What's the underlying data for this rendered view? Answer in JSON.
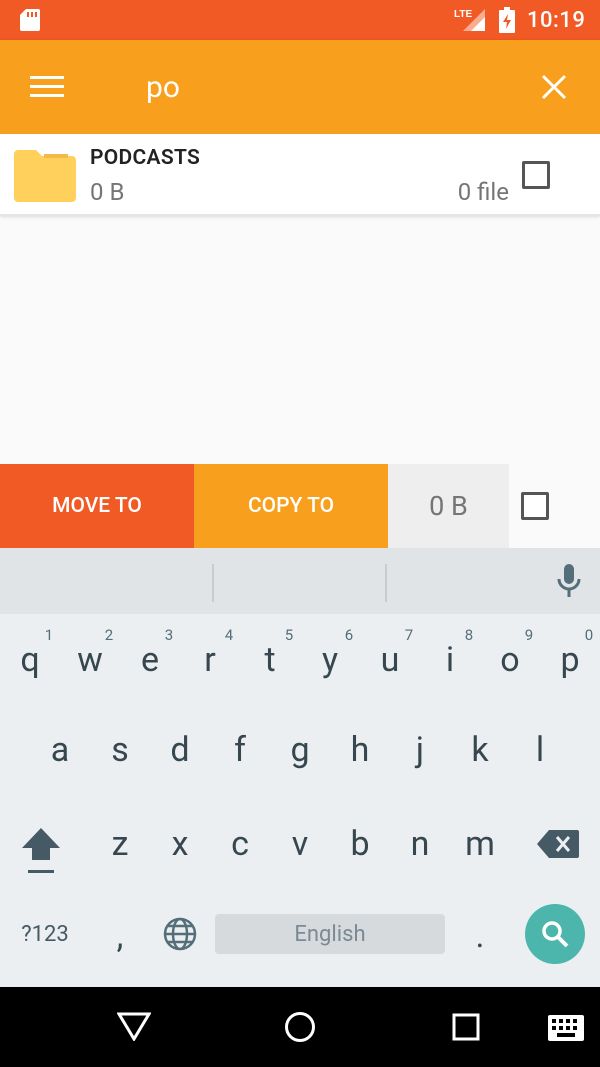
{
  "status_bar": {
    "time": "10:19",
    "network": "LTE",
    "icons": [
      "sd-card-icon",
      "lte-signal-icon",
      "battery-charging-icon"
    ]
  },
  "app_bar": {
    "search_query": "po",
    "icons": [
      "menu-icon",
      "close-icon"
    ]
  },
  "results": [
    {
      "name": "PODCASTS",
      "size": "0 B",
      "count": "0 file",
      "icon": "folder-icon"
    }
  ],
  "action_bar": {
    "move_label": "MOVE TO",
    "copy_label": "COPY TO",
    "selected_size": "0 B"
  },
  "keyboard": {
    "row1": [
      "q",
      "w",
      "e",
      "r",
      "t",
      "y",
      "u",
      "i",
      "o",
      "p"
    ],
    "row1_hints": [
      "1",
      "2",
      "3",
      "4",
      "5",
      "6",
      "7",
      "8",
      "9",
      "0"
    ],
    "row2": [
      "a",
      "s",
      "d",
      "f",
      "g",
      "h",
      "j",
      "k",
      "l"
    ],
    "row3": [
      "z",
      "x",
      "c",
      "v",
      "b",
      "n",
      "m"
    ],
    "symbols_label": "?123",
    "comma": ",",
    "period": ".",
    "space_label": "English"
  },
  "colors": {
    "status_bar": "#f15a24",
    "app_bar": "#f8a01e",
    "move_button": "#f15a24",
    "copy_button": "#f8a01e",
    "search_key": "#4db6ac"
  }
}
